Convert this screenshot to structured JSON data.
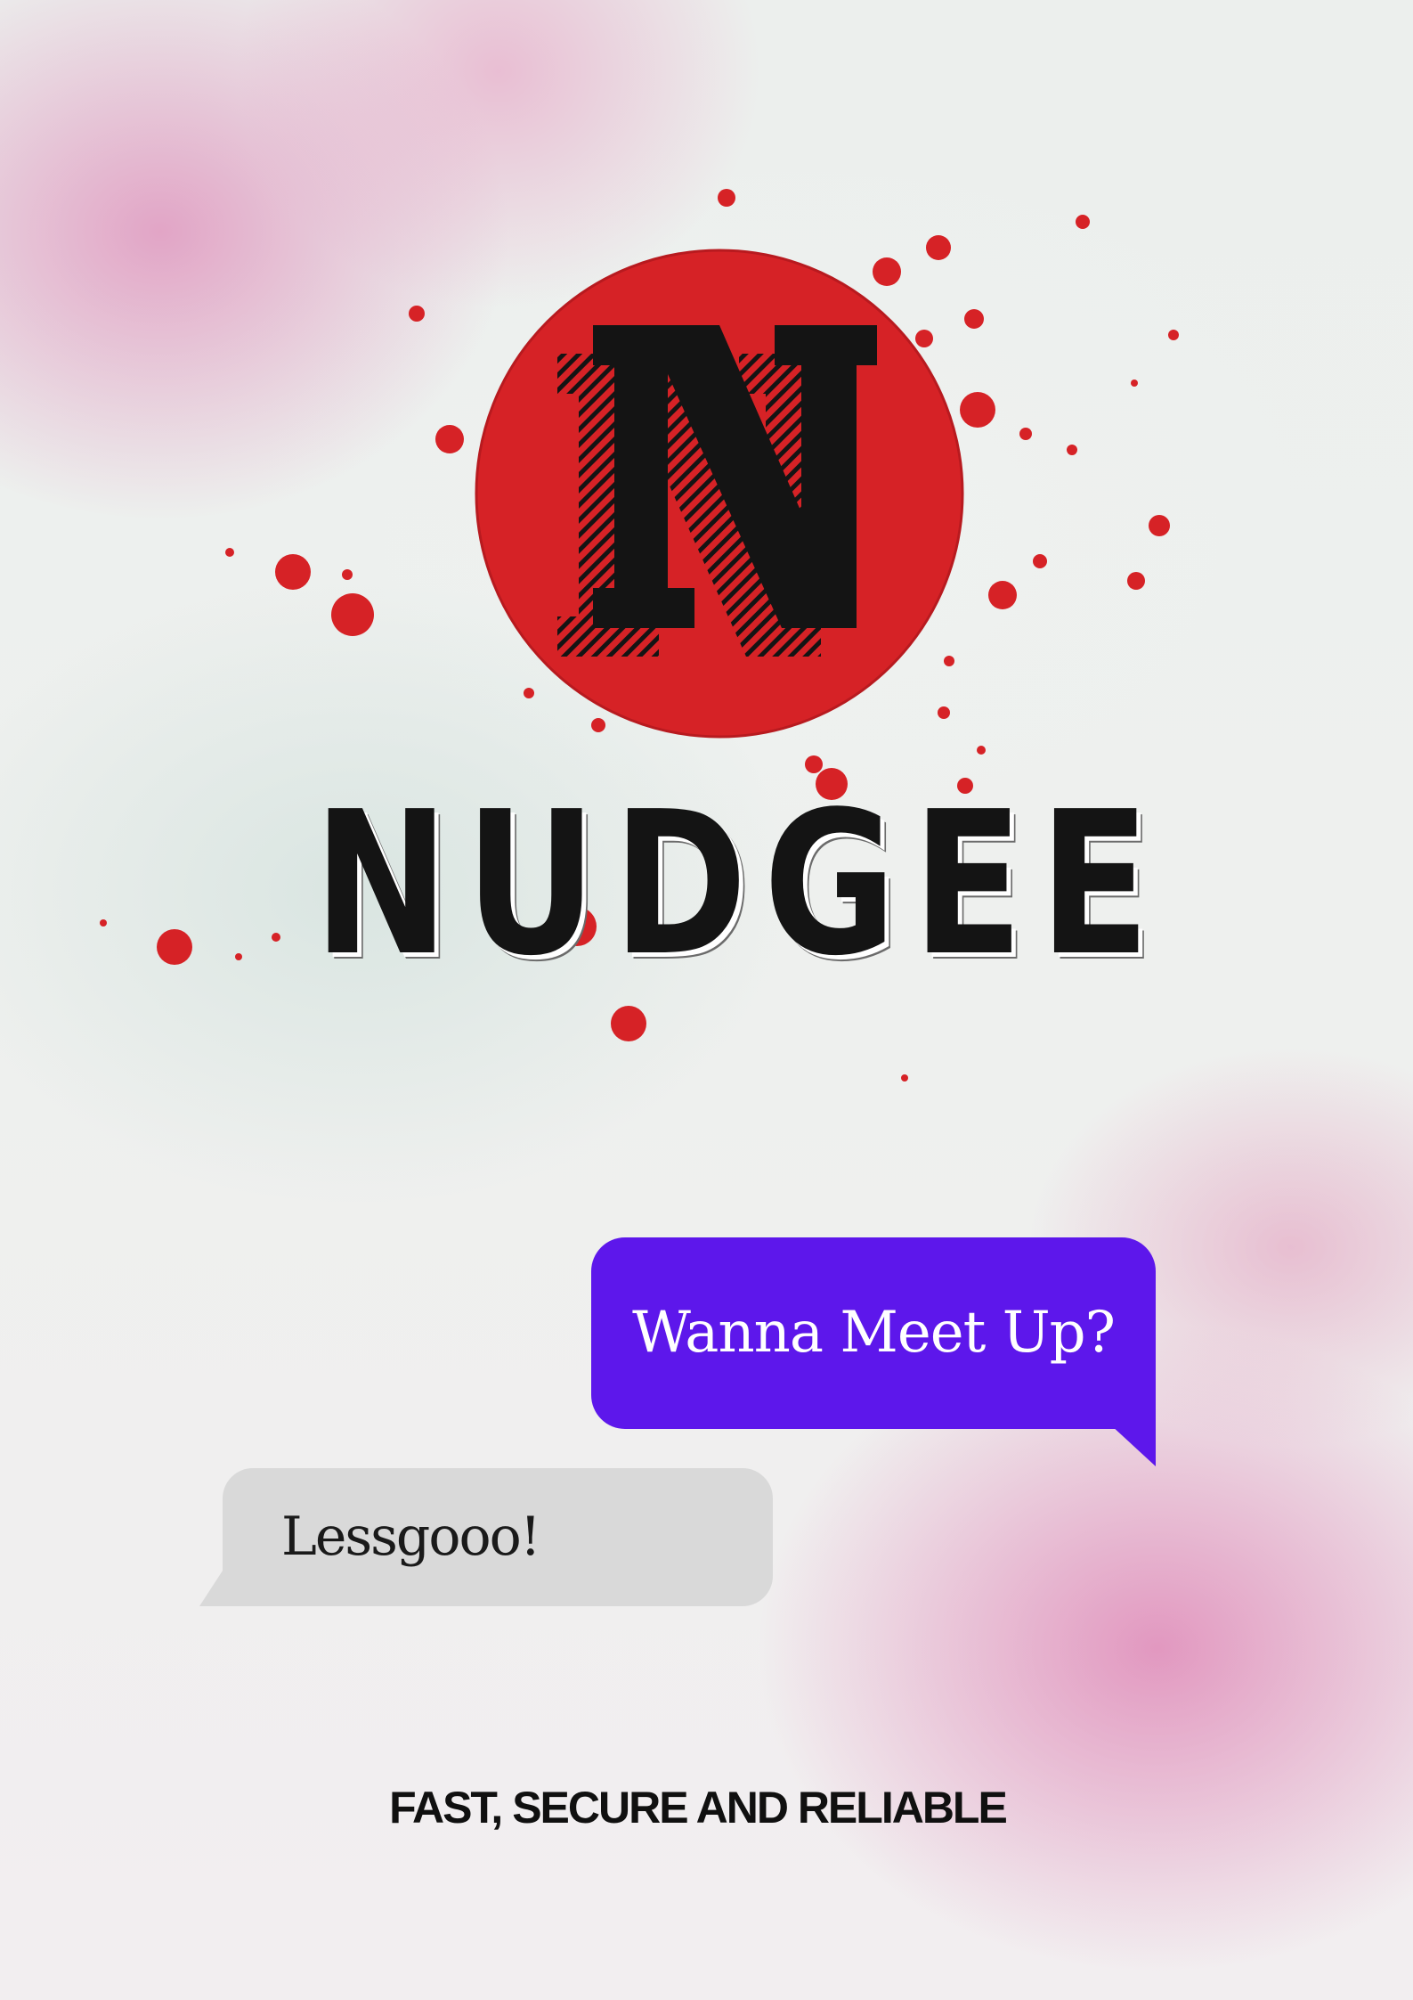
{
  "brand": {
    "logo_letter": "N",
    "name": "NUDGEE",
    "logo_color": "#d62226",
    "text_color": "#141414"
  },
  "chat": {
    "sent_message": "Wanna Meet Up?",
    "sent_bubble_color": "#5d17eb",
    "received_message": "Lessgooo!",
    "received_bubble_color": "#d9d9d9"
  },
  "tagline": "FAST, SECURE AND RELIABLE"
}
